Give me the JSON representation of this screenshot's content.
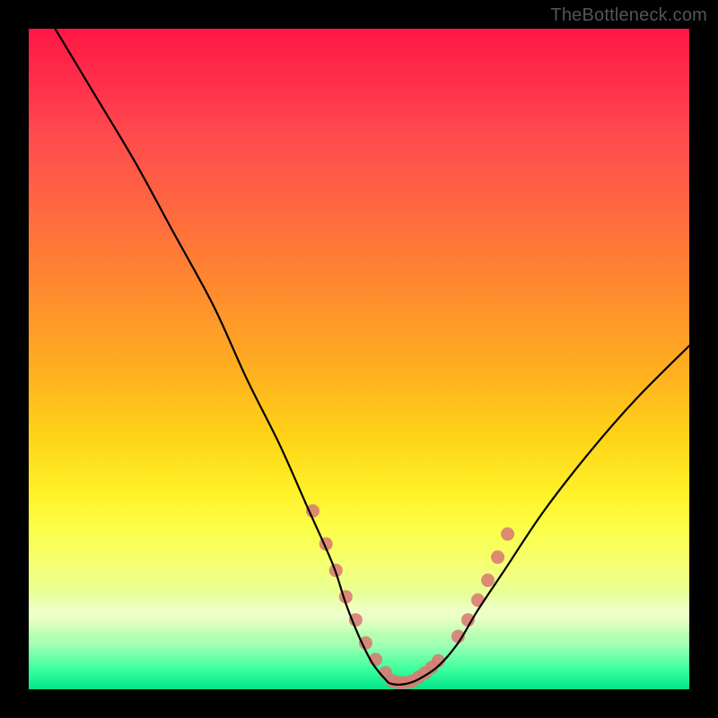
{
  "watermark": "TheBottleneck.com",
  "chart_data": {
    "type": "line",
    "title": "",
    "xlabel": "",
    "ylabel": "",
    "xlim": [
      0,
      100
    ],
    "ylim": [
      0,
      100
    ],
    "grid": false,
    "legend": false,
    "background_gradient": {
      "direction": "top-to-bottom",
      "stops": [
        {
          "pos": 0,
          "color": "#ff1744"
        },
        {
          "pos": 16,
          "color": "#ff4a4e"
        },
        {
          "pos": 40,
          "color": "#ff8c2f"
        },
        {
          "pos": 62,
          "color": "#ffd417"
        },
        {
          "pos": 76,
          "color": "#fcff4a"
        },
        {
          "pos": 93,
          "color": "#a6ffb4"
        },
        {
          "pos": 100,
          "color": "#00e58a"
        }
      ]
    },
    "pale_band_y_range_pct_from_top": [
      85,
      92
    ],
    "series": [
      {
        "name": "bottleneck-curve",
        "color": "#000000",
        "stroke_width": 2.2,
        "x": [
          4,
          10,
          16,
          22,
          28,
          33,
          38,
          42,
          46,
          48,
          50,
          52,
          54,
          55,
          57,
          59,
          62,
          65,
          68,
          72,
          78,
          85,
          92,
          100
        ],
        "y": [
          100,
          90,
          80,
          69,
          58,
          47,
          37,
          28,
          19,
          13,
          8,
          4,
          1.5,
          0.8,
          0.8,
          1.5,
          3.5,
          7,
          12,
          18,
          27,
          36,
          44,
          52
        ]
      }
    ],
    "markers": {
      "name": "dot-markers",
      "color": "#d97a72",
      "radius": 7.5,
      "points_xy": [
        [
          43,
          27
        ],
        [
          45,
          22
        ],
        [
          46.5,
          18
        ],
        [
          48,
          14
        ],
        [
          49.5,
          10.5
        ],
        [
          51,
          7
        ],
        [
          52.5,
          4.5
        ],
        [
          54,
          2.5
        ],
        [
          55,
          1.3
        ],
        [
          56,
          1
        ],
        [
          57,
          1
        ],
        [
          58,
          1.2
        ],
        [
          59,
          1.8
        ],
        [
          60,
          2.5
        ],
        [
          61,
          3.3
        ],
        [
          62,
          4.3
        ],
        [
          65,
          8
        ],
        [
          66.5,
          10.5
        ],
        [
          68,
          13.5
        ],
        [
          69.5,
          16.5
        ],
        [
          71,
          20
        ],
        [
          72.5,
          23.5
        ]
      ]
    }
  }
}
